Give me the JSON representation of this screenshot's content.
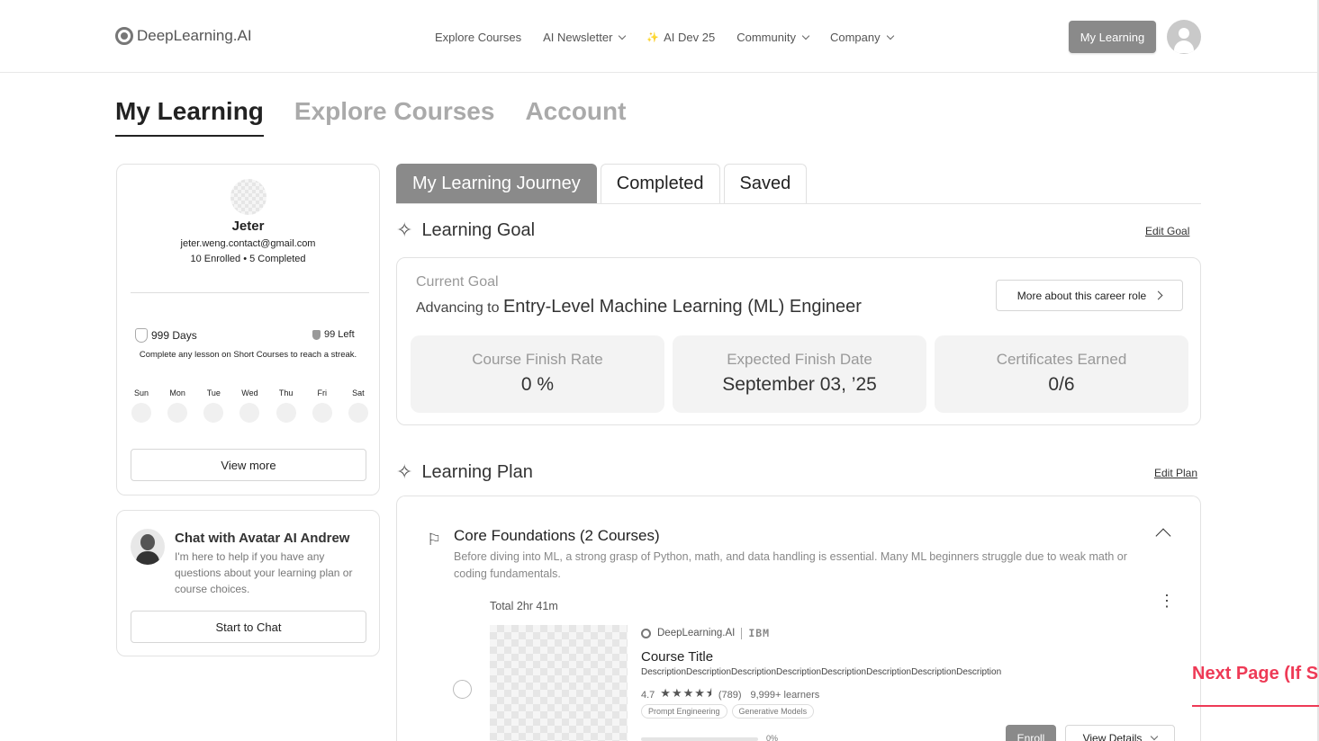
{
  "nav": {
    "logo_text": "DeepLearning.AI",
    "links": [
      "Explore Courses",
      "AI Newsletter",
      "AI Dev 25",
      "Community",
      "Company"
    ],
    "my_learning_button": "My Learning"
  },
  "page_tabs": [
    "My Learning",
    "Explore Courses",
    "Account"
  ],
  "profile": {
    "name": "Jeter",
    "email": "jeter.weng.contact@gmail.com",
    "stats": "10 Enrolled • 5 Completed",
    "streak_days": "999 Days",
    "left_count": "99 Left",
    "streak_hint": "Complete any lesson on Short Courses to reach a streak.",
    "weekdays": [
      "Sun",
      "Mon",
      "Tue",
      "Wed",
      "Thu",
      "Fri",
      "Sat"
    ],
    "view_more": "View more"
  },
  "chat": {
    "title": "Chat with Avatar AI Andrew",
    "description": "I'm here to help if you have any questions about your learning plan or course choices.",
    "button": "Start to Chat"
  },
  "journey_tabs": [
    "My Learning Journey",
    "Completed",
    "Saved"
  ],
  "goal": {
    "section_title": "Learning Goal",
    "edit_link": "Edit Goal",
    "current_label": "Current Goal",
    "advancing_prefix": "Advancing to",
    "role": "Entry-Level Machine Learning  (ML) Engineer",
    "career_button": "More about this career role",
    "metrics": [
      {
        "label": "Course Finish Rate",
        "value": "0 %"
      },
      {
        "label": "Expected Finish Date",
        "value": "September 03, ’25"
      },
      {
        "label": "Certificates Earned",
        "value": "0/6"
      }
    ]
  },
  "plan": {
    "section_title": "Learning Plan",
    "edit_link": "Edit Plan",
    "group_title": "Core Foundations (2 Courses)",
    "group_desc": "Before diving into ML, a strong grasp of Python, math, and data handling is essential. Many ML beginners struggle due to weak math or coding fundamentals.",
    "total": "Total 2hr 41m",
    "course": {
      "org1": "DeepLearning.AI",
      "org2": "IBM",
      "title": "Course Title",
      "description": "DescriptionDescriptionDescriptionDescriptionDescriptionDescriptionDescriptionDescription",
      "rating": "4.7",
      "stars": "★★★★⯨",
      "reviews": "(789)",
      "learners": "9,999+ learners",
      "tags": [
        "Prompt Engineering",
        "Generative Models"
      ],
      "progress": "0%",
      "progress_value": 0,
      "enroll": "Enroll",
      "view_details": "View Details"
    }
  },
  "annotation": "Next Page (If S"
}
